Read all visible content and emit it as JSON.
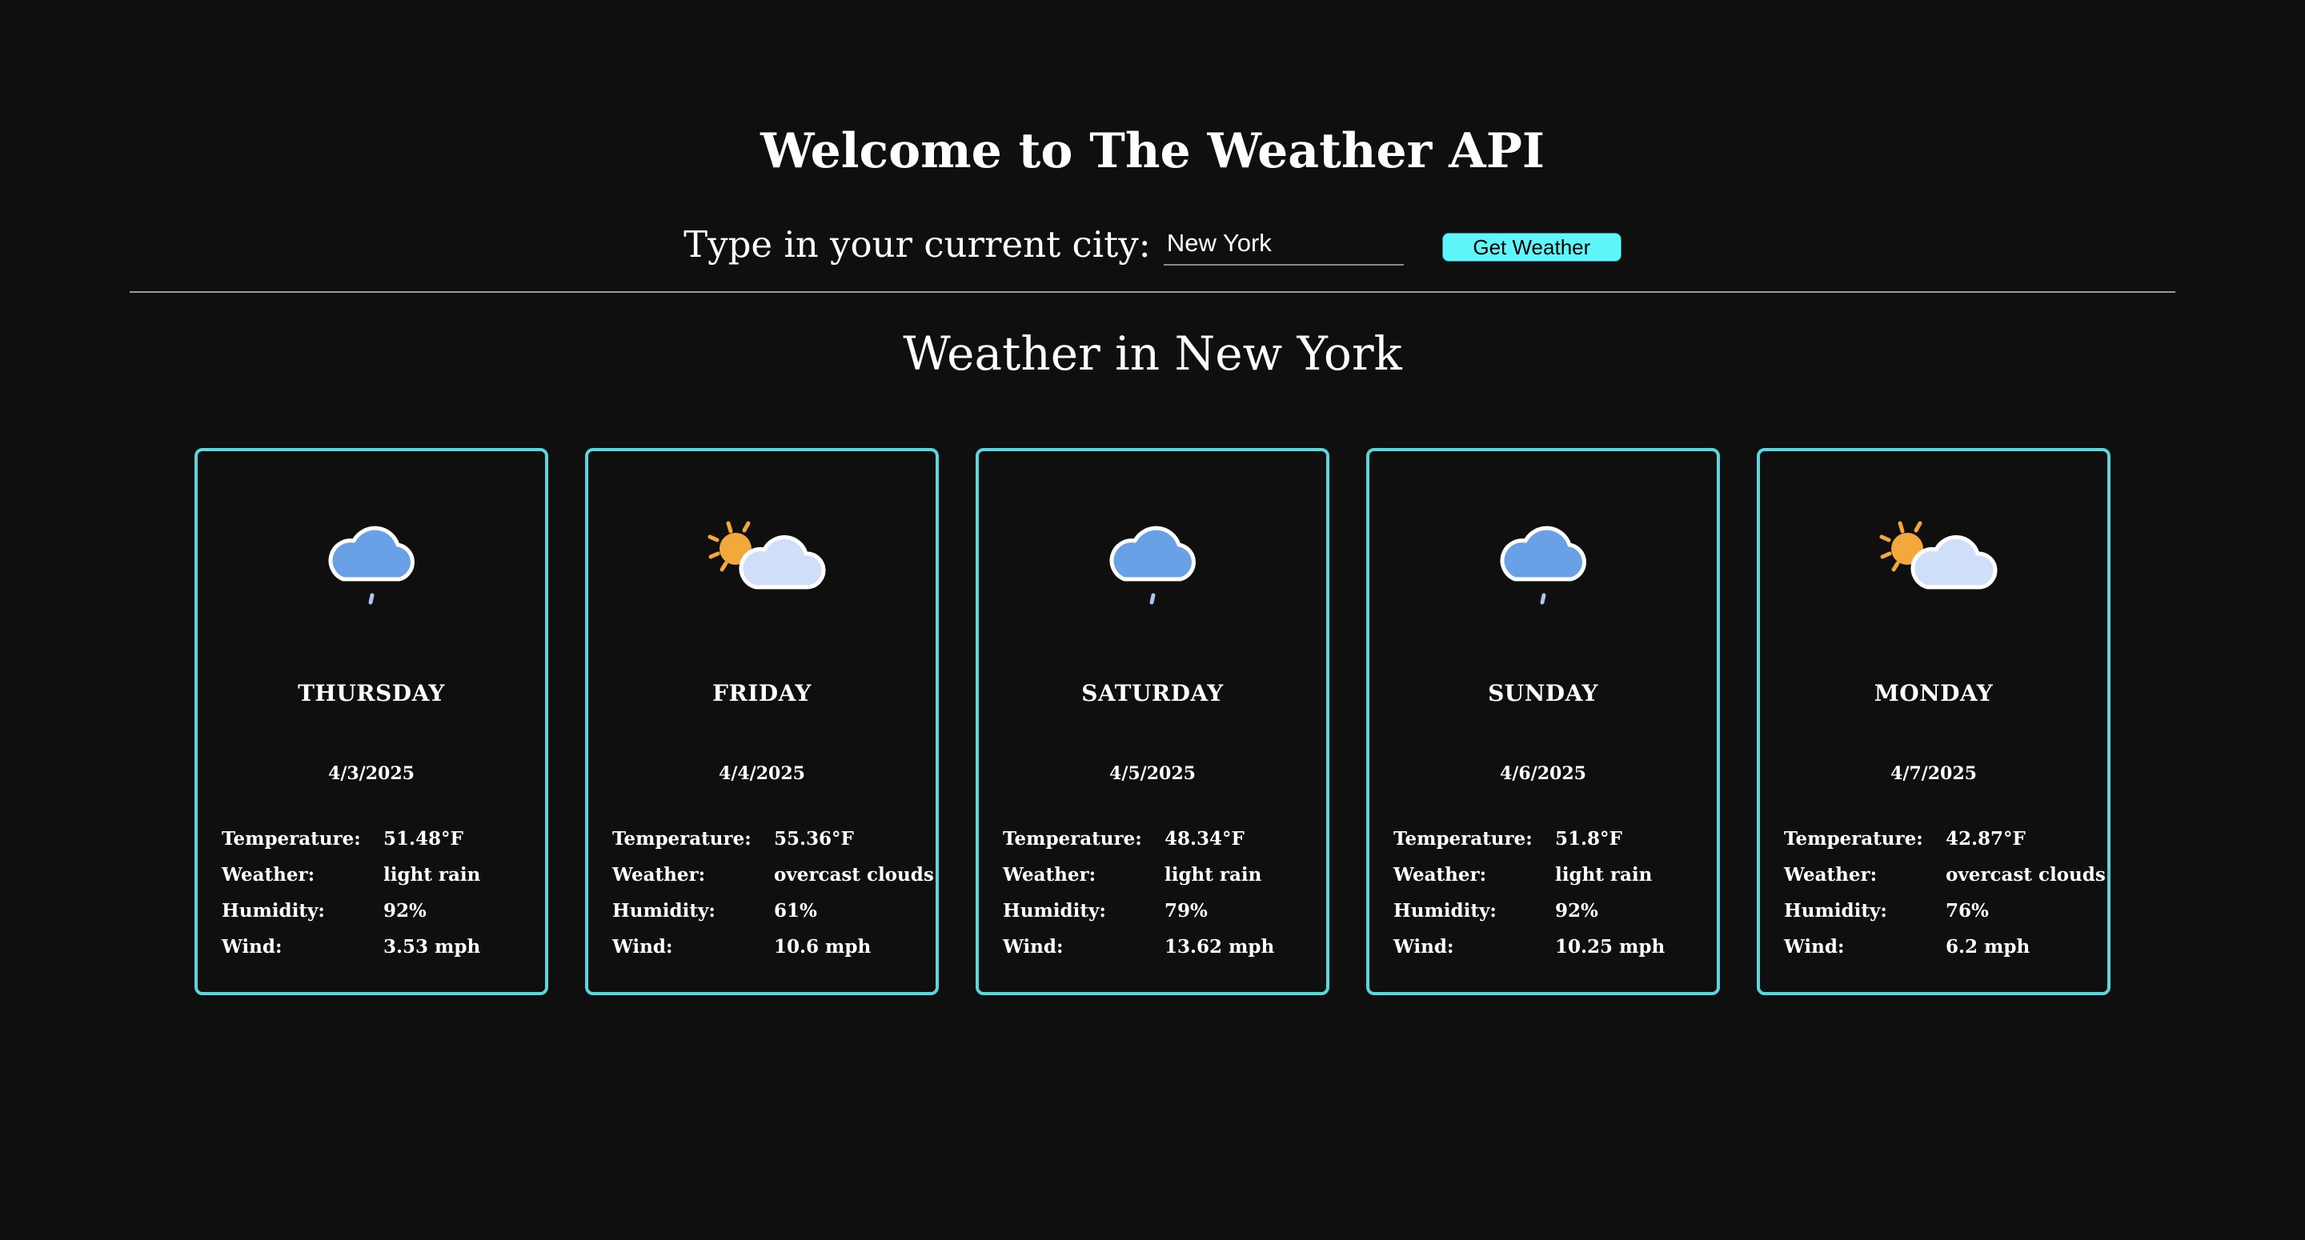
{
  "header": {
    "title": "Welcome to The Weather API",
    "city_label": "Type in your current city:",
    "city_value": "New York",
    "button_label": "Get Weather"
  },
  "results": {
    "heading": "Weather in New York",
    "labels": {
      "temperature": "Temperature:",
      "weather": "Weather:",
      "humidity": "Humidity:",
      "wind": "Wind:"
    },
    "days": [
      {
        "day": "THURSDAY",
        "date": "4/3/2025",
        "temperature": "51.48°F",
        "weather": "light rain",
        "humidity": "92%",
        "wind": "3.53 mph",
        "icon": "rain-cloud-icon"
      },
      {
        "day": "FRIDAY",
        "date": "4/4/2025",
        "temperature": "55.36°F",
        "weather": "overcast clouds",
        "humidity": "61%",
        "wind": "10.6 mph",
        "icon": "sun-cloud-icon"
      },
      {
        "day": "SATURDAY",
        "date": "4/5/2025",
        "temperature": "48.34°F",
        "weather": "light rain",
        "humidity": "79%",
        "wind": "13.62 mph",
        "icon": "rain-cloud-icon"
      },
      {
        "day": "SUNDAY",
        "date": "4/6/2025",
        "temperature": "51.8°F",
        "weather": "light rain",
        "humidity": "92%",
        "wind": "10.25 mph",
        "icon": "rain-cloud-icon"
      },
      {
        "day": "MONDAY",
        "date": "4/7/2025",
        "temperature": "42.87°F",
        "weather": "overcast clouds",
        "humidity": "76%",
        "wind": "6.2 mph",
        "icon": "sun-cloud-icon"
      }
    ]
  },
  "colors": {
    "background": "#0f0f0f",
    "card_border": "#5ad7de",
    "button": "#5ff6fb",
    "rain_cloud": "#6aa1e6",
    "light_cloud": "#cfdff9",
    "sun": "#f3a83b"
  }
}
